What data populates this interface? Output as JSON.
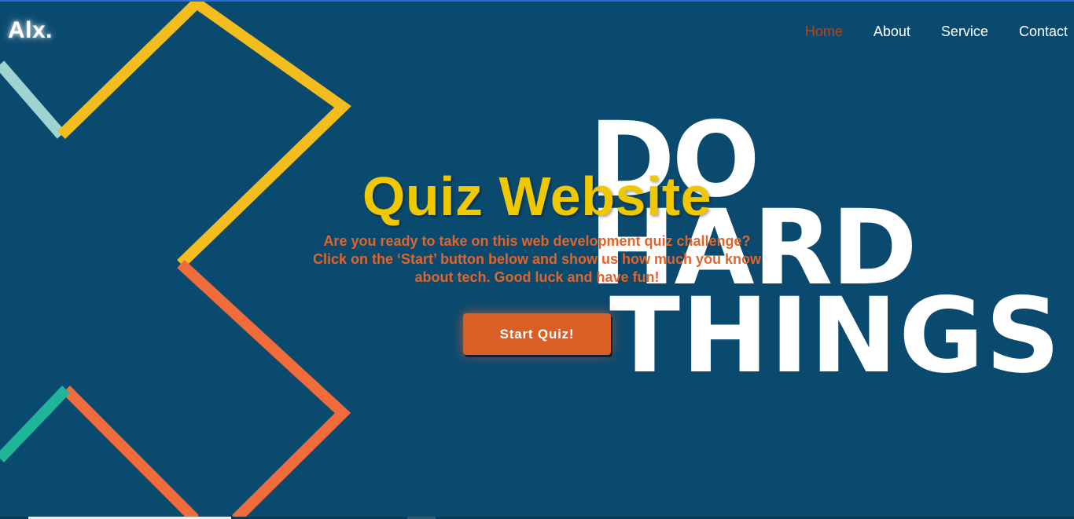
{
  "brand": {
    "logo_text": "Alx."
  },
  "nav": {
    "items": [
      {
        "label": "Home",
        "active": true
      },
      {
        "label": "About",
        "active": false
      },
      {
        "label": "Service",
        "active": false
      },
      {
        "label": "Contact",
        "active": false
      }
    ]
  },
  "hero": {
    "title": "Quiz Website",
    "description": "Are you ready to take on this web development quiz challenge? Click on the ‘Start’ button below and show us how much you know about tech. Good luck and have fun!",
    "start_button_label": "Start Quiz!"
  },
  "background": {
    "slogan_lines": [
      "DO",
      "HARD",
      "THINGS"
    ]
  },
  "colors": {
    "background": "#0b4a6f",
    "title_yellow": "#f0c800",
    "description_orange": "#e0652b",
    "button_orange": "#d95f26",
    "nav_active": "#b3451c",
    "stripe_yellow": "#f2bd1d",
    "stripe_orange": "#f26b3a",
    "stripe_teal": "#1fb59b",
    "stripe_light_teal": "#9fd3cf"
  }
}
